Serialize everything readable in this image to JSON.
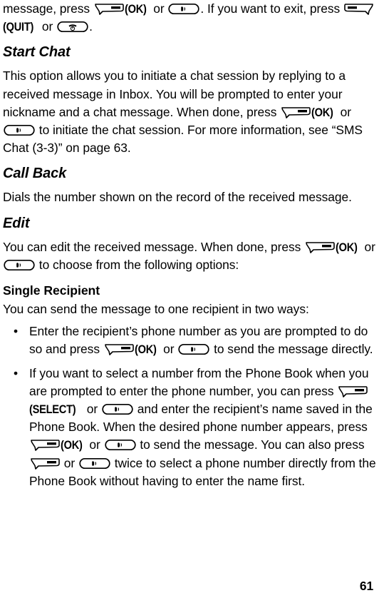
{
  "document": {
    "page_number": "61",
    "type": "mobile-phone-user-manual-page"
  },
  "icons": {
    "softkey_right": "right-softkey-icon",
    "softkey_left": "left-softkey-icon",
    "send_key": "send-call-key-icon",
    "end_key": "end-power-key-icon"
  },
  "key_labels": {
    "ok": "(OK)",
    "quit": "(QUIT)",
    "select": "(SELECT)"
  },
  "content": {
    "intro_para": {
      "seg1": "message, press ",
      "seg2": " or ",
      "seg3": ". If you want to exit, press ",
      "seg4": " or ",
      "seg5": "."
    },
    "start_chat": {
      "heading": "Start Chat",
      "seg1": "This option allows you to initiate a chat session by replying to a received message in Inbox. You will be prompted to enter your nickname and a chat message. When done, press ",
      "seg2": " or ",
      "seg3": " to initiate the chat session. For more information, see “SMS Chat (3-3)” on page 63."
    },
    "call_back": {
      "heading": "Call Back",
      "body": "Dials the number shown on the record of the received message."
    },
    "edit": {
      "heading": "Edit",
      "seg1": "You can edit the received message. When done, press ",
      "seg2": " or ",
      "seg3": " to choose from the following options:"
    },
    "single_recipient": {
      "heading": "Single Recipient",
      "intro": "You can send the message to one recipient in two ways:",
      "bullet_marker": "•",
      "bullet1": {
        "seg1": "Enter the recipient’s phone number as you are prompted to do so and press ",
        "seg2": " or ",
        "seg3": " to send the message directly."
      },
      "bullet2": {
        "seg1": "If you want to select a number from the Phone Book when you are prompted to enter the phone number, you can press ",
        "seg2": " or ",
        "seg3": " and enter the recipient’s name saved in the Phone Book. When the desired phone number appears, press ",
        "seg4": " or ",
        "seg5": " to send the message. You can also press ",
        "seg6": " or ",
        "seg7": " twice to select a phone number directly from the Phone Book without having to enter the name first."
      }
    }
  }
}
